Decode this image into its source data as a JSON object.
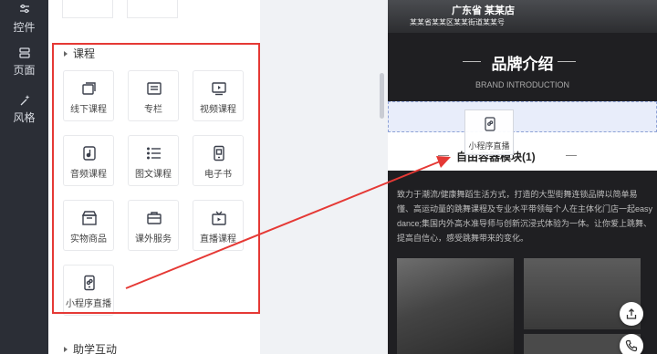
{
  "rail": {
    "items": [
      {
        "label": "控件",
        "icon": "sliders-icon"
      },
      {
        "label": "页面",
        "icon": "page-icon"
      },
      {
        "label": "风格",
        "icon": "magic-wand-icon"
      }
    ]
  },
  "widgets": {
    "course_section_title": "课程",
    "course_items": [
      {
        "label": "线下课程",
        "icon": "offline-course-icon"
      },
      {
        "label": "专栏",
        "icon": "column-icon"
      },
      {
        "label": "视频课程",
        "icon": "video-course-icon"
      },
      {
        "label": "音频课程",
        "icon": "audio-course-icon"
      },
      {
        "label": "图文课程",
        "icon": "article-course-icon"
      },
      {
        "label": "电子书",
        "icon": "ebook-icon"
      },
      {
        "label": "实物商品",
        "icon": "physical-goods-icon"
      },
      {
        "label": "课外服务",
        "icon": "service-icon"
      },
      {
        "label": "直播课程",
        "icon": "live-course-icon"
      },
      {
        "label": "小程序直播",
        "icon": "miniapp-live-icon"
      }
    ],
    "interaction_section_title": "助学互动"
  },
  "preview": {
    "hero_title": "广东省 某某店",
    "hero_subtitle": "某某省某某区某某街道某某号",
    "brand_title": "品牌介绍",
    "brand_en": "BRAND INTRODUCTION",
    "drag_ghost_label": "小程序直播",
    "module_title": "自由容器模块(1)",
    "description": "致力于潮流/健康舞蹈生活方式，打造的大型街舞连锁品牌以简单易懂、高运动量的跳舞课程及专业水平带领每个人在主体化门店一起easy dance;集国内外高水准导师与创新沉浸式体验为一体。让你爱上跳舞、提高自信心，感受跳舞带来的变化。"
  },
  "float_buttons": [
    {
      "icon": "share-upload-icon"
    },
    {
      "icon": "phone-icon"
    }
  ],
  "colors": {
    "highlight_frame": "#e53935",
    "annotation_arrow": "#e53935",
    "rail_bg": "#2b2e36",
    "preview_bg": "#1f1f22"
  }
}
